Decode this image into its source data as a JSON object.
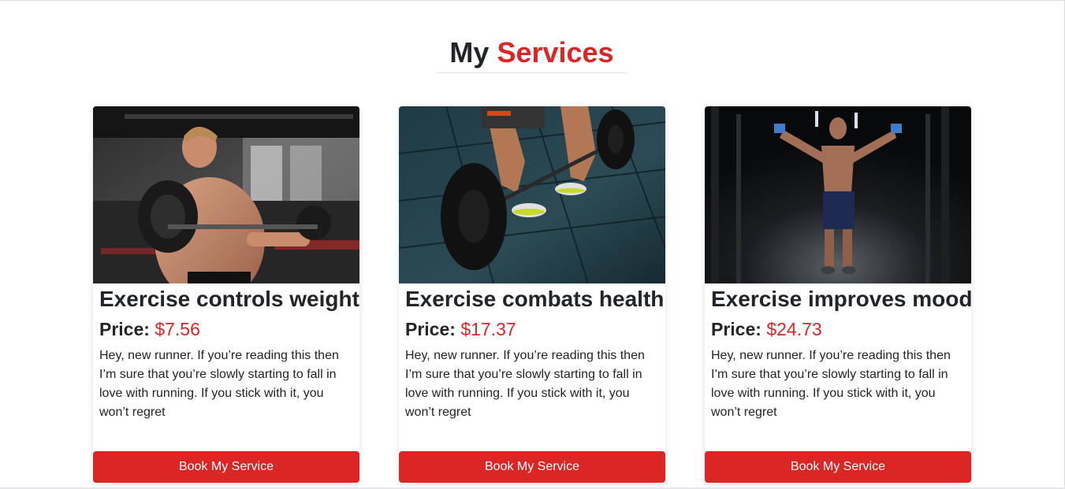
{
  "section": {
    "title_part1": "My",
    "title_part2": "Services",
    "accent_color": "#dc2626"
  },
  "cards": [
    {
      "image": "man-curling-barbell-gym-photo",
      "title": "Exercise controls weight",
      "price_label": "Price:",
      "price_value": "$7.56",
      "description": "Hey, new runner. If you’re reading this then I’m sure that you’re slowly starting to fall in love with running. If you stick with it, you won’t regret",
      "button_label": "Book My Service"
    },
    {
      "image": "barbell-deadlift-floor-photo",
      "title": "Exercise combats health",
      "price_label": "Price:",
      "price_value": "$17.37",
      "description": "Hey, new runner. If you’re reading this then I’m sure that you’re slowly starting to fall in love with running. If you stick with it, you won’t regret",
      "button_label": "Book My Service"
    },
    {
      "image": "man-cable-crossover-dark-gym-photo",
      "title": "Exercise improves mood",
      "price_label": "Price:",
      "price_value": "$24.73",
      "description": "Hey, new runner. If you’re reading this then I’m sure that you’re slowly starting to fall in love with running. If you stick with it, you won’t regret",
      "button_label": "Book My Service"
    }
  ]
}
